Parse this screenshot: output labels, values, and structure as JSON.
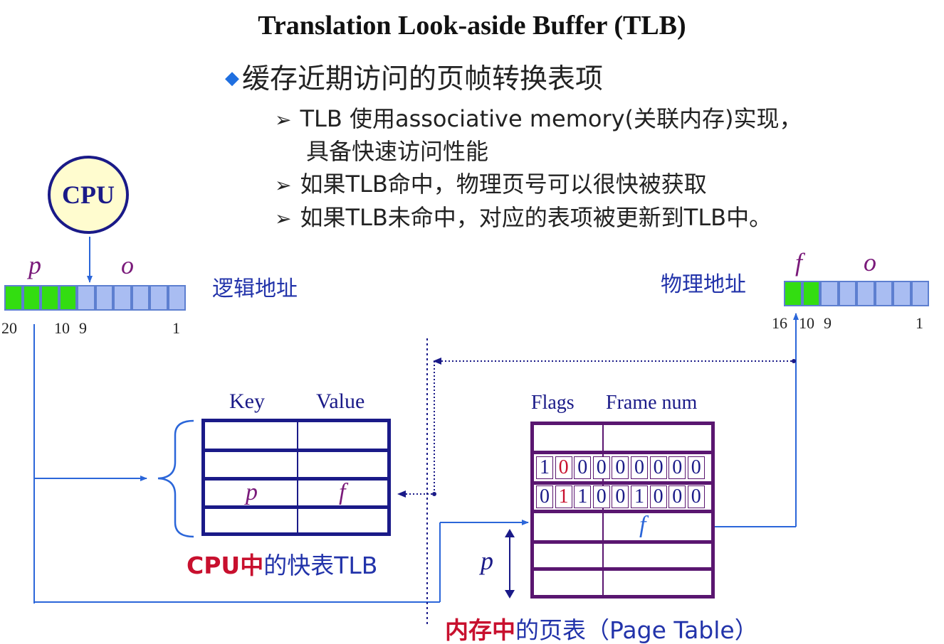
{
  "title": "Translation Look-aside Buffer (TLB)",
  "bullet": {
    "marker": "◆",
    "text": "缓存近期访问的页帧转换表项",
    "sub_marker": "➢",
    "items": [
      {
        "line1": "TLB 使用associative memory(关联内存)实现，",
        "line2": "具备快速访问性能"
      },
      {
        "line1": "如果TLB命中，物理页号可以很快被获取"
      },
      {
        "line1": "如果TLB未命中，对应的表项被更新到TLB中。"
      }
    ]
  },
  "cpu_label": "CPU",
  "logical_address": {
    "label": "逻辑地址",
    "p": "p",
    "o": "o",
    "bits_total": 10,
    "bits_p": 4,
    "ticks": {
      "left": "20",
      "mid1": "10",
      "mid2": "9",
      "right": "1"
    }
  },
  "physical_address": {
    "label": "物理地址",
    "f": "f",
    "o": "o",
    "bits_total": 8,
    "bits_f": 2,
    "ticks": {
      "left": "16",
      "mid1": "10",
      "mid2": "9",
      "right": "1"
    }
  },
  "tlb": {
    "key_header": "Key",
    "value_header": "Value",
    "p": "p",
    "f": "f",
    "caption_red": "CPU中",
    "caption_rest": "的快表TLB"
  },
  "page_table": {
    "flags_header": "Flags",
    "frame_header": "Frame num",
    "row1": [
      "1",
      "0",
      "0",
      "0",
      "0",
      "0",
      "0",
      "0",
      "0"
    ],
    "row2": [
      "0",
      "1",
      "1",
      "0",
      "0",
      "1",
      "0",
      "0",
      "0"
    ],
    "f": "f",
    "p": "p",
    "caption_red": "内存中",
    "caption_rest": "的页表（Page Table）"
  },
  "colors": {
    "navy": "#1a1a88",
    "purple": "#5a1670",
    "green": "#33dd11",
    "reg_blue": "#a9bdf2",
    "line_blue": "#2b66d9",
    "red": "#c8102e"
  }
}
